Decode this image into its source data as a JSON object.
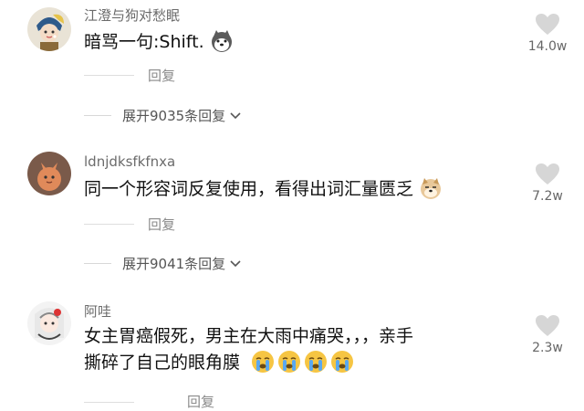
{
  "comments": [
    {
      "username": "江澄与狗对愁眠",
      "text": "暗骂一句:Shift.",
      "emojis": [
        "husky-emoji"
      ],
      "reply_label": "回复",
      "likes": "14.0w",
      "expand_label": "展开9035条回复"
    },
    {
      "username": "ldnjdksfkfnxa",
      "text": "同一个形容词反复使用，看得出词汇量匮乏",
      "emojis": [
        "doge-emoji"
      ],
      "reply_label": "回复",
      "likes": "7.2w",
      "expand_label": "展开9041条回复"
    },
    {
      "username": "阿哇",
      "text_line1": "女主胃癌假死，男主在大雨中痛哭，，，亲手",
      "text_line2": "撕碎了自己的眼角膜",
      "emojis": [
        "crying-emoji",
        "crying-emoji",
        "crying-emoji",
        "crying-emoji"
      ],
      "reply_label": "回复",
      "likes": "2.3w"
    }
  ],
  "colors": {
    "text": "#111111",
    "meta": "#6b6b6b",
    "heart": "#d6d6d6"
  }
}
